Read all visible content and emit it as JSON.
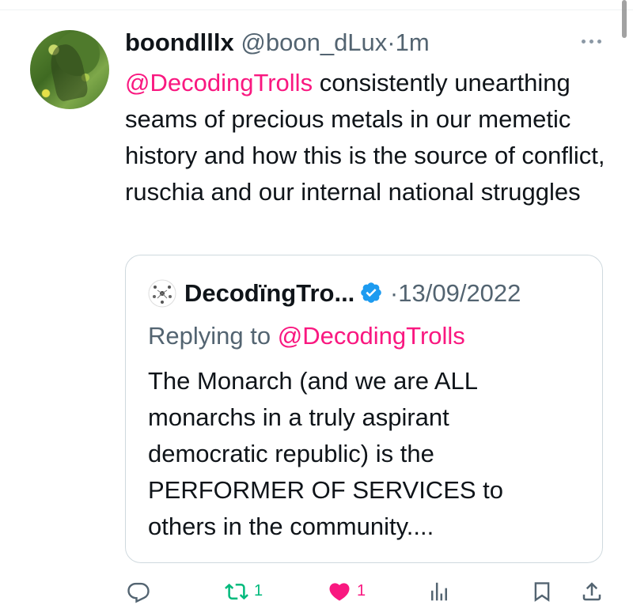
{
  "tweet": {
    "author_name": "boondlllx",
    "handle": "@boon_dLux",
    "separator": "·",
    "time": "1m",
    "body_mention": "@DecodingTrolls",
    "body_text": " consistently unearthing seams of precious metals in our memetic history and how this is the source of conflict, ruschia and our internal national struggles"
  },
  "quote": {
    "author_name": "DecodïngTro...",
    "separator": "·",
    "date": "13/09/2022",
    "replying_prefix": "Replying to ",
    "replying_to": "@DecodingTrolls",
    "text": "The Monarch (and we are ALL monarchs in a truly aspirant democratic republic) is the PERFORMER OF SERVICES to others in the community...."
  },
  "actions": {
    "retweet_count": "1",
    "like_count": "1"
  },
  "colors": {
    "accent": "#f91880",
    "retweet": "#00ba7c",
    "verified": "#1d9bf0",
    "muted": "#536471"
  },
  "icons": {
    "more": "more-horizontal-icon",
    "verified": "verified-badge-icon",
    "reply": "reply-icon",
    "retweet": "retweet-icon",
    "like": "heart-filled-icon",
    "views": "views-bar-chart-icon",
    "bookmark": "bookmark-icon",
    "share": "share-icon"
  }
}
